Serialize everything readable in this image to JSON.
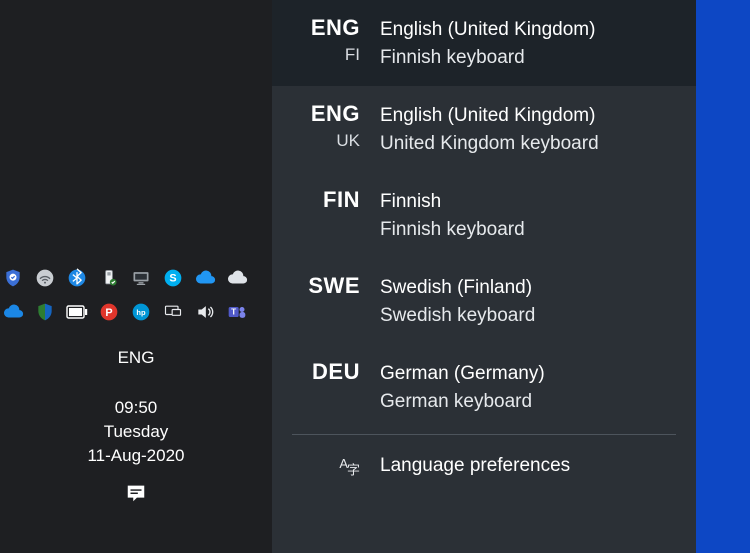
{
  "tray": {
    "rows": [
      [
        {
          "name": "shield-update-icon",
          "interact": true
        },
        {
          "name": "wifi-icon",
          "interact": true
        },
        {
          "name": "bluetooth-icon",
          "interact": true
        },
        {
          "name": "usb-eject-icon",
          "interact": true
        },
        {
          "name": "monitor-icon",
          "interact": true
        },
        {
          "name": "skype-icon",
          "interact": true
        },
        {
          "name": "cloud-blue-icon",
          "interact": true
        },
        {
          "name": "cloud-grey-icon",
          "interact": true
        }
      ],
      [
        {
          "name": "onedrive-icon",
          "interact": true
        },
        {
          "name": "security-shield-icon",
          "interact": true
        },
        {
          "name": "battery-icon",
          "interact": true
        },
        {
          "name": "p-app-icon",
          "interact": true
        },
        {
          "name": "hp-icon",
          "interact": true
        },
        {
          "name": "display-settings-icon",
          "interact": true
        },
        {
          "name": "volume-icon",
          "interact": true
        },
        {
          "name": "teams-icon",
          "interact": true
        }
      ]
    ],
    "current_lang": "ENG",
    "clock": {
      "time": "09:50",
      "day": "Tuesday",
      "date": "11-Aug-2020"
    }
  },
  "flyout": {
    "items": [
      {
        "code": "ENG",
        "sub": "FI",
        "lang": "English (United Kingdom)",
        "kbd": "Finnish keyboard",
        "active": true
      },
      {
        "code": "ENG",
        "sub": "UK",
        "lang": "English (United Kingdom)",
        "kbd": "United Kingdom keyboard",
        "active": false
      },
      {
        "code": "FIN",
        "sub": "",
        "lang": "Finnish",
        "kbd": "Finnish keyboard",
        "active": false
      },
      {
        "code": "SWE",
        "sub": "",
        "lang": "Swedish (Finland)",
        "kbd": "Swedish keyboard",
        "active": false
      },
      {
        "code": "DEU",
        "sub": "",
        "lang": "German (Germany)",
        "kbd": "German keyboard",
        "active": false
      }
    ],
    "prefs_label": "Language preferences"
  }
}
